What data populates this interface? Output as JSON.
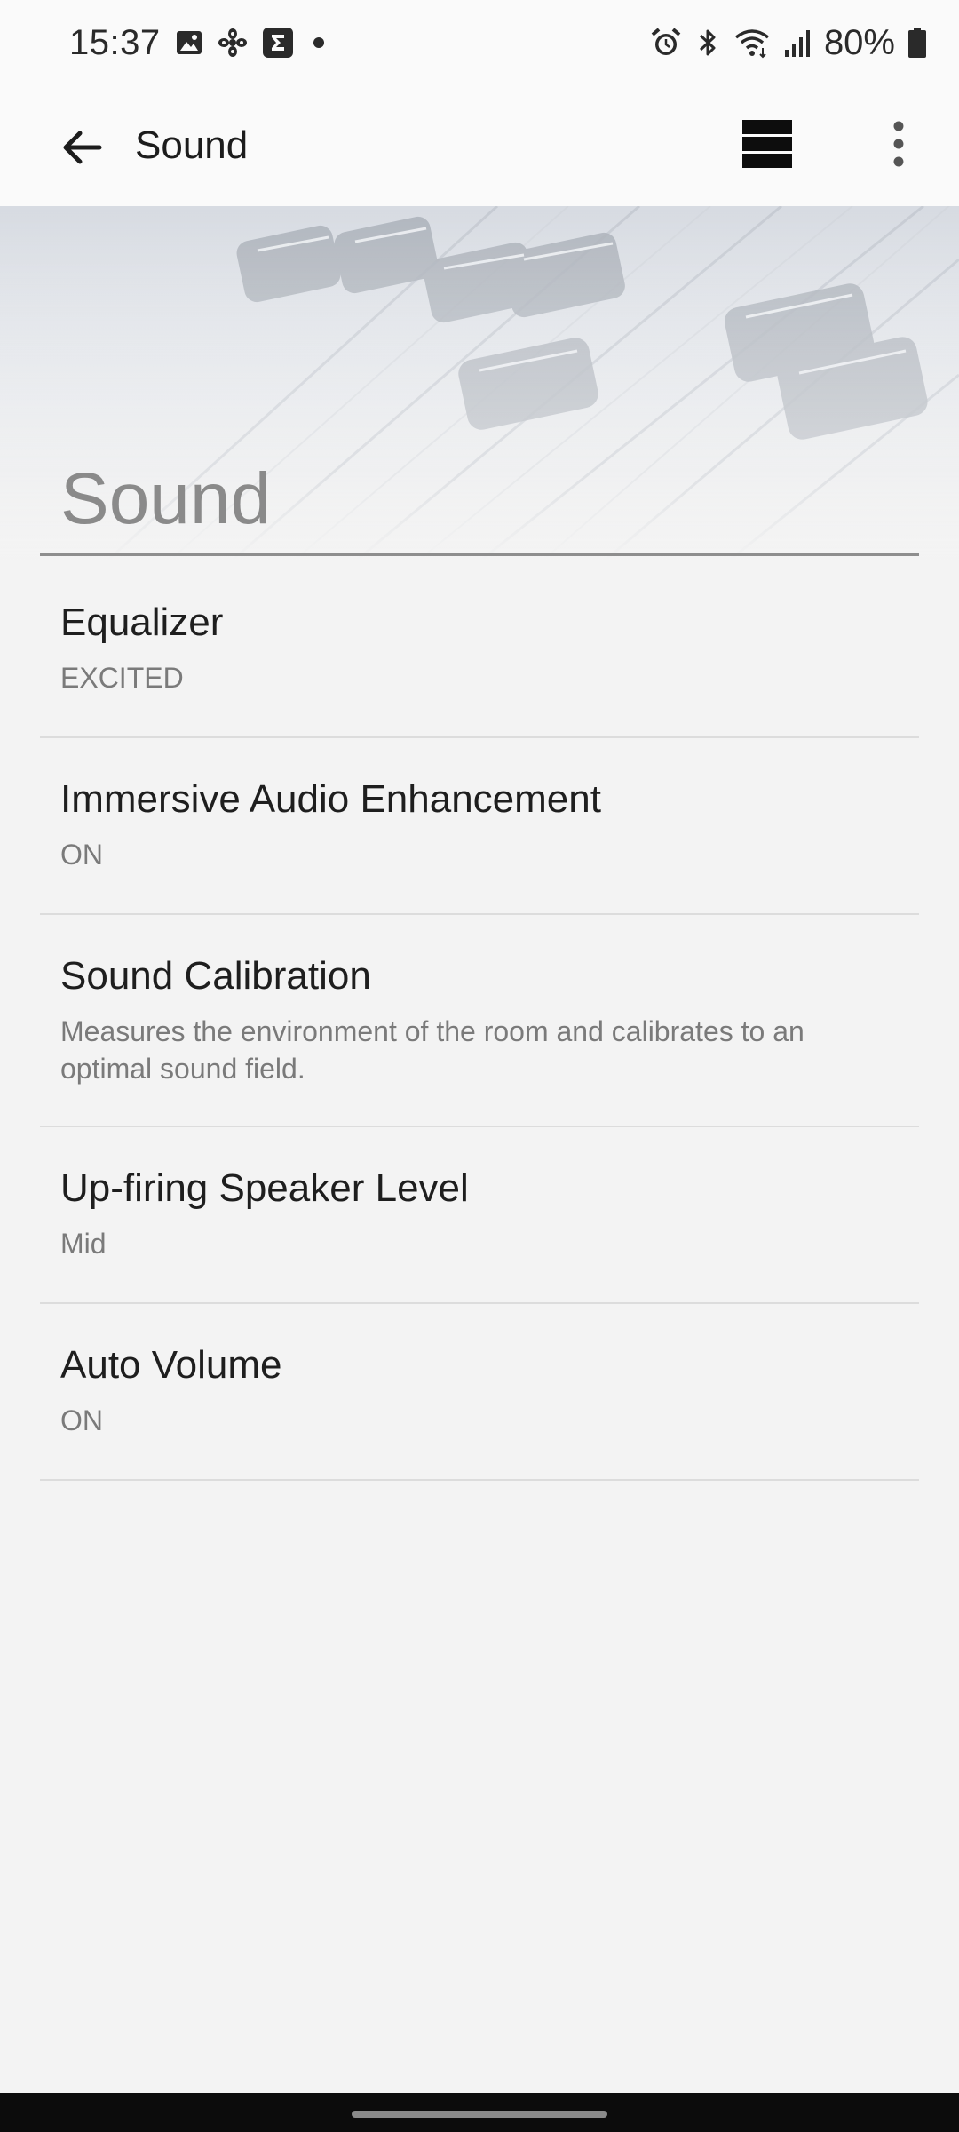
{
  "status_bar": {
    "time": "15:37",
    "left_icons": [
      "gallery-icon",
      "pinwheel-icon",
      "sigma-icon",
      "dot-icon"
    ],
    "right_icons": [
      "alarm-icon",
      "bluetooth-icon",
      "wifi-icon",
      "signal-icon",
      "battery-icon"
    ],
    "battery_percent": "80%"
  },
  "app_bar": {
    "title": "Sound",
    "back_icon": "arrow-back-icon",
    "view_toggle_icon": "view-list-icon",
    "more_icon": "more-vert-icon"
  },
  "header": {
    "title": "Sound",
    "background": "mixing-console-faders"
  },
  "settings": [
    {
      "title": "Equalizer",
      "summary": "EXCITED"
    },
    {
      "title": "Immersive Audio Enhancement",
      "summary": "ON"
    },
    {
      "title": "Sound Calibration",
      "summary": "Measures the environment of the room and calibrates to an optimal sound field."
    },
    {
      "title": "Up-firing Speaker Level",
      "summary": "Mid"
    },
    {
      "title": "Auto Volume",
      "summary": "ON"
    }
  ],
  "colors": {
    "background": "#f3f3f3",
    "bar_background": "#fafafa",
    "primary_text": "#1e1e1e",
    "secondary_text": "#7a7a7a",
    "divider": "#dcdcdc",
    "nav_bar": "#0c0c0c"
  }
}
